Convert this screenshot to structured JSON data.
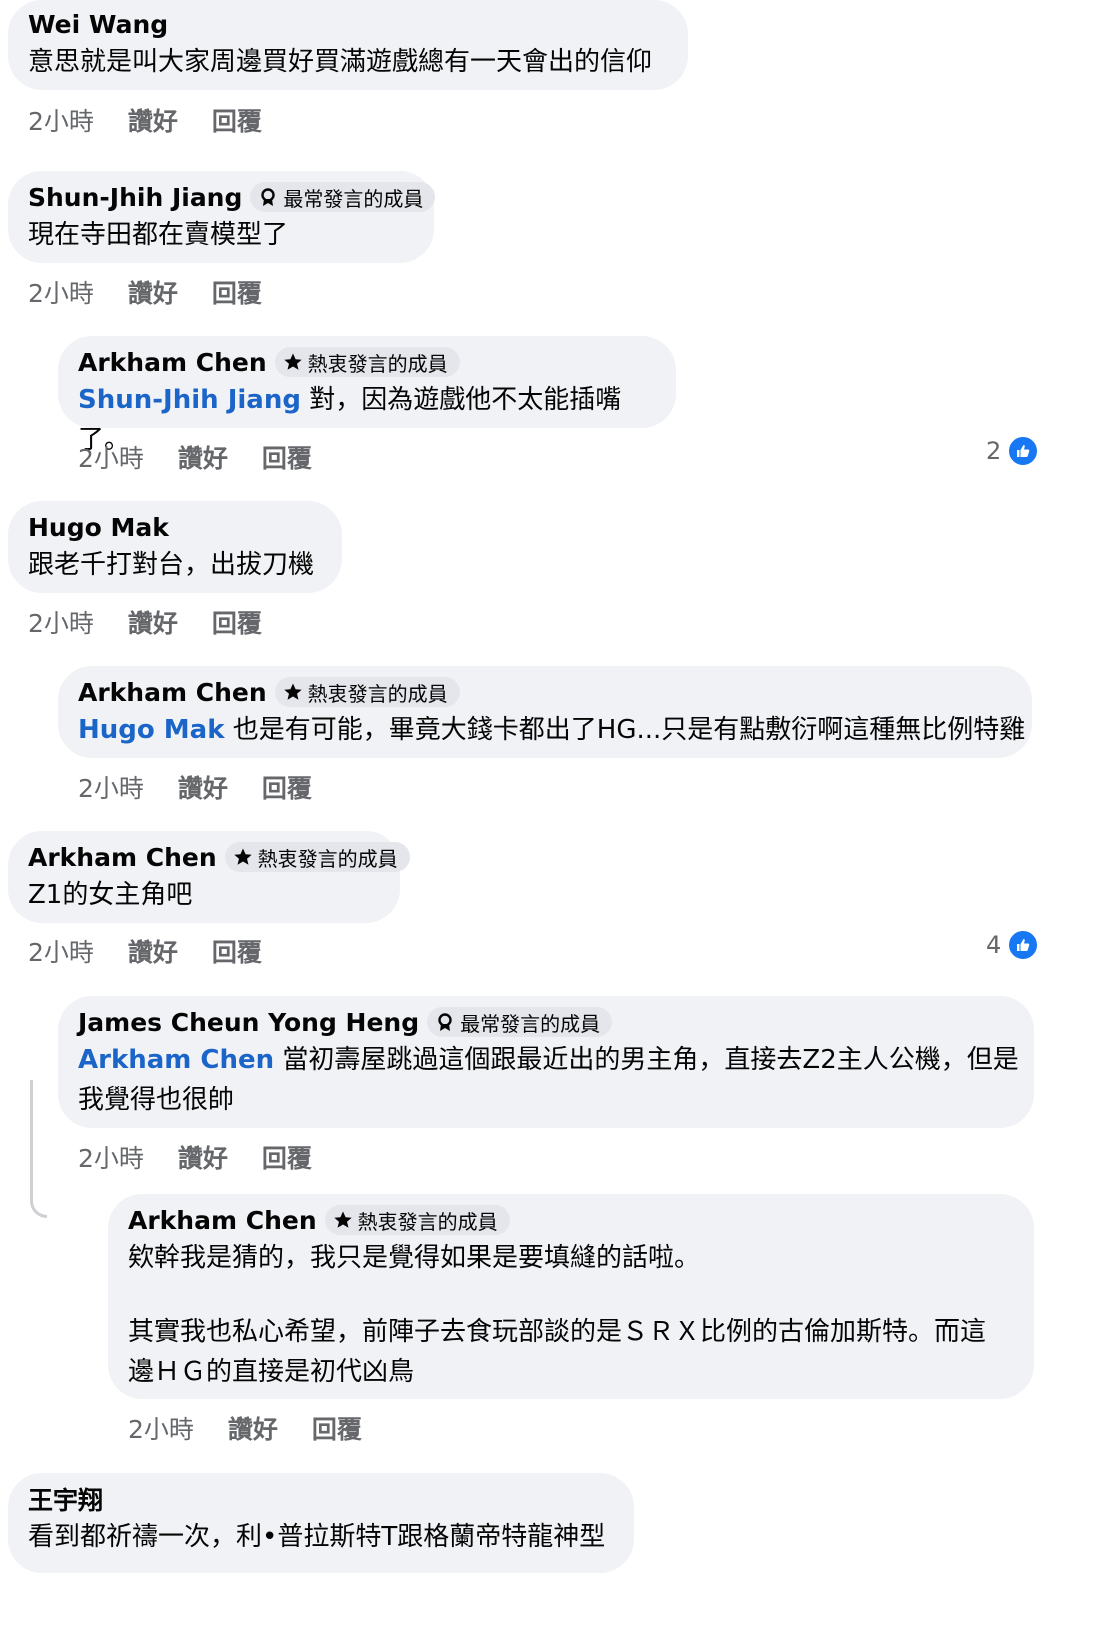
{
  "labels": {
    "like": "讚好",
    "reply": "回覆"
  },
  "comments": [
    {
      "author": "Wei Wang",
      "text": "意思就是叫大家周邊買好買滿遊戲總有一天會出的信仰",
      "time": "2小時"
    },
    {
      "author": "Shun-Jhih Jiang",
      "badge": "最常發言的成員",
      "badge_icon": "top-contributor-icon",
      "text": "現在寺田都在賣模型了",
      "time": "2小時"
    },
    {
      "author": "Arkham Chen",
      "badge": "熱衷發言的成員",
      "badge_icon": "star-icon",
      "mention": "Shun-Jhih Jiang",
      "text": " 對，因為遊戲他不太能插嘴了。",
      "time": "2小時",
      "reaction_count": "2"
    },
    {
      "author": "Hugo Mak",
      "text": "跟老千打對台，出拔刀機",
      "time": "2小時"
    },
    {
      "author": "Arkham Chen",
      "badge": "熱衷發言的成員",
      "badge_icon": "star-icon",
      "mention": "Hugo Mak",
      "text": " 也是有可能，畢竟大錢卡都出了HG...只是有點敷衍啊這種無比例特雞",
      "time": "2小時"
    },
    {
      "author": "Arkham Chen",
      "badge": "熱衷發言的成員",
      "badge_icon": "star-icon",
      "text": "Z1的女主角吧",
      "time": "2小時",
      "reaction_count": "4"
    },
    {
      "author": "James Cheun Yong Heng",
      "badge": "最常發言的成員",
      "badge_icon": "top-contributor-icon",
      "mention": "Arkham Chen",
      "text": " 當初壽屋跳過這個跟最近出的男主角，直接去Z2主人公機，但是",
      "text2": "我覺得也很帥",
      "time": "2小時"
    },
    {
      "author": "Arkham Chen",
      "badge": "熱衷發言的成員",
      "badge_icon": "star-icon",
      "text": "欸幹我是猜的，我只是覺得如果是要填縫的話啦。",
      "text2": "其實我也私心希望，前陣子去食玩部談的是ＳＲＸ比例的古倫加斯特。而這",
      "text3": "邊ＨＧ的直接是初代凶鳥",
      "time": "2小時"
    },
    {
      "author": "王宇翔",
      "text": "看到都祈禱一次，利•普拉斯特T跟格蘭帝特龍神型"
    }
  ]
}
